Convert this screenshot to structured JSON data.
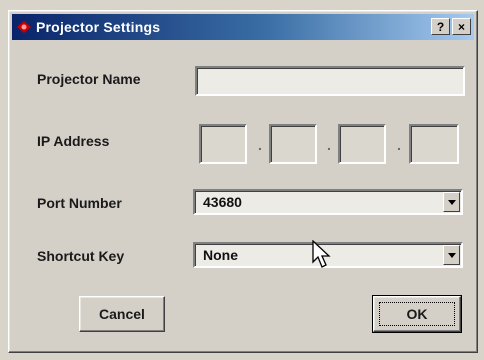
{
  "window": {
    "title": "Projector Settings",
    "help_button": "?",
    "close_button": "×"
  },
  "form": {
    "projector_name": {
      "label": "Projector Name",
      "value": ""
    },
    "ip_address": {
      "label": "IP Address",
      "octets": [
        "",
        "",
        "",
        ""
      ],
      "separator": "."
    },
    "port_number": {
      "label": "Port Number",
      "value": "43680"
    },
    "shortcut_key": {
      "label": "Shortcut Key",
      "value": "None"
    }
  },
  "buttons": {
    "cancel": "Cancel",
    "ok": "OK"
  },
  "colors": {
    "title_start": "#0a246a",
    "title_end": "#a6caf0",
    "app_icon": "#cc0000"
  },
  "icons": {
    "app": "projector-icon",
    "help": "help-icon",
    "close": "close-icon",
    "dropdown": "chevron-down-icon",
    "cursor": "mouse-pointer-icon"
  }
}
